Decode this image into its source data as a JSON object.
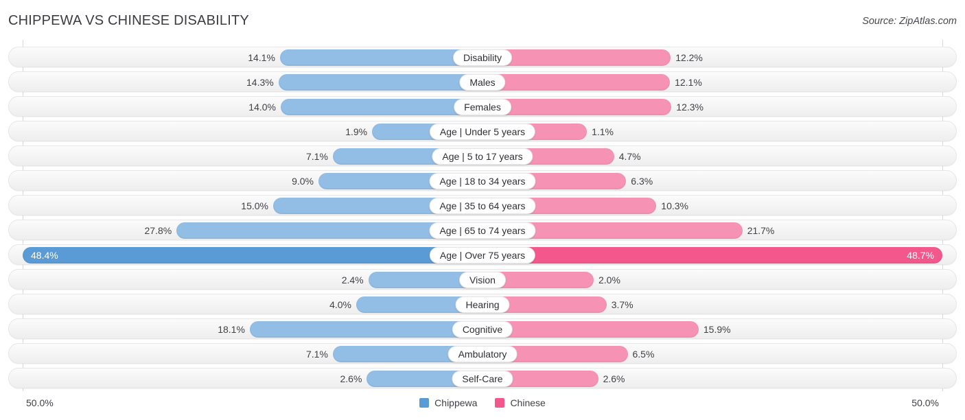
{
  "header": {
    "title": "CHIPPEWA VS CHINESE DISABILITY",
    "source": "Source: ZipAtlas.com"
  },
  "axis": {
    "left_label": "50.0%",
    "right_label": "50.0%"
  },
  "legend": {
    "items": [
      {
        "label": "Chippewa",
        "color": "#5b9bd5"
      },
      {
        "label": "Chinese",
        "color": "#f2588c"
      }
    ]
  },
  "colors": {
    "left_bar": "#92bde4",
    "right_bar": "#f693b5",
    "left_bar_emphasis": "#5b9bd5",
    "right_bar_emphasis": "#f2588c",
    "row_track": "#f4f4f4",
    "gridline": "#d7d7dc",
    "text": "#404046"
  },
  "chart_data": {
    "type": "bar",
    "title": "CHIPPEWA VS CHINESE DISABILITY",
    "subtitle": "Source: ZipAtlas.com",
    "orientation": "horizontal-diverging",
    "xlabel": "",
    "ylabel": "",
    "xlim": [
      -50.0,
      50.0
    ],
    "axis_tick_labels": [
      "50.0%",
      "50.0%"
    ],
    "grid": true,
    "legend_position": "bottom-center",
    "categories": [
      "Disability",
      "Males",
      "Females",
      "Age | Under 5 years",
      "Age | 5 to 17 years",
      "Age | 18 to 34 years",
      "Age | 35 to 64 years",
      "Age | 65 to 74 years",
      "Age | Over 75 years",
      "Vision",
      "Hearing",
      "Cognitive",
      "Ambulatory",
      "Self-Care"
    ],
    "series": [
      {
        "name": "Chippewa",
        "color": "#5b9bd5",
        "values": [
          14.1,
          14.3,
          14.0,
          1.9,
          7.1,
          9.0,
          15.0,
          27.8,
          48.4,
          2.4,
          4.0,
          18.1,
          7.1,
          2.6
        ]
      },
      {
        "name": "Chinese",
        "color": "#f2588c",
        "values": [
          12.2,
          12.1,
          12.3,
          1.1,
          4.7,
          6.3,
          10.3,
          21.7,
          48.7,
          2.0,
          3.7,
          15.9,
          6.5,
          2.6
        ]
      }
    ]
  },
  "rows": [
    {
      "label": "Disability",
      "left": "14.1%",
      "right": "12.2%",
      "left_value": 14.1,
      "right_value": 12.2,
      "emphasis": false
    },
    {
      "label": "Males",
      "left": "14.3%",
      "right": "12.1%",
      "left_value": 14.3,
      "right_value": 12.1,
      "emphasis": false
    },
    {
      "label": "Females",
      "left": "14.0%",
      "right": "12.3%",
      "left_value": 14.0,
      "right_value": 12.3,
      "emphasis": false
    },
    {
      "label": "Age | Under 5 years",
      "left": "1.9%",
      "right": "1.1%",
      "left_value": 1.9,
      "right_value": 1.1,
      "emphasis": false
    },
    {
      "label": "Age | 5 to 17 years",
      "left": "7.1%",
      "right": "4.7%",
      "left_value": 7.1,
      "right_value": 4.7,
      "emphasis": false
    },
    {
      "label": "Age | 18 to 34 years",
      "left": "9.0%",
      "right": "6.3%",
      "left_value": 9.0,
      "right_value": 6.3,
      "emphasis": false
    },
    {
      "label": "Age | 35 to 64 years",
      "left": "15.0%",
      "right": "10.3%",
      "left_value": 15.0,
      "right_value": 10.3,
      "emphasis": false
    },
    {
      "label": "Age | 65 to 74 years",
      "left": "27.8%",
      "right": "21.7%",
      "left_value": 27.8,
      "right_value": 21.7,
      "emphasis": false
    },
    {
      "label": "Age | Over 75 years",
      "left": "48.4%",
      "right": "48.7%",
      "left_value": 48.4,
      "right_value": 48.7,
      "emphasis": true
    },
    {
      "label": "Vision",
      "left": "2.4%",
      "right": "2.0%",
      "left_value": 2.4,
      "right_value": 2.0,
      "emphasis": false
    },
    {
      "label": "Hearing",
      "left": "4.0%",
      "right": "3.7%",
      "left_value": 4.0,
      "right_value": 3.7,
      "emphasis": false
    },
    {
      "label": "Cognitive",
      "left": "18.1%",
      "right": "15.9%",
      "left_value": 18.1,
      "right_value": 15.9,
      "emphasis": false
    },
    {
      "label": "Ambulatory",
      "left": "7.1%",
      "right": "6.5%",
      "left_value": 7.1,
      "right_value": 6.5,
      "emphasis": false
    },
    {
      "label": "Self-Care",
      "left": "2.6%",
      "right": "2.6%",
      "left_value": 2.6,
      "right_value": 2.6,
      "emphasis": false
    }
  ]
}
